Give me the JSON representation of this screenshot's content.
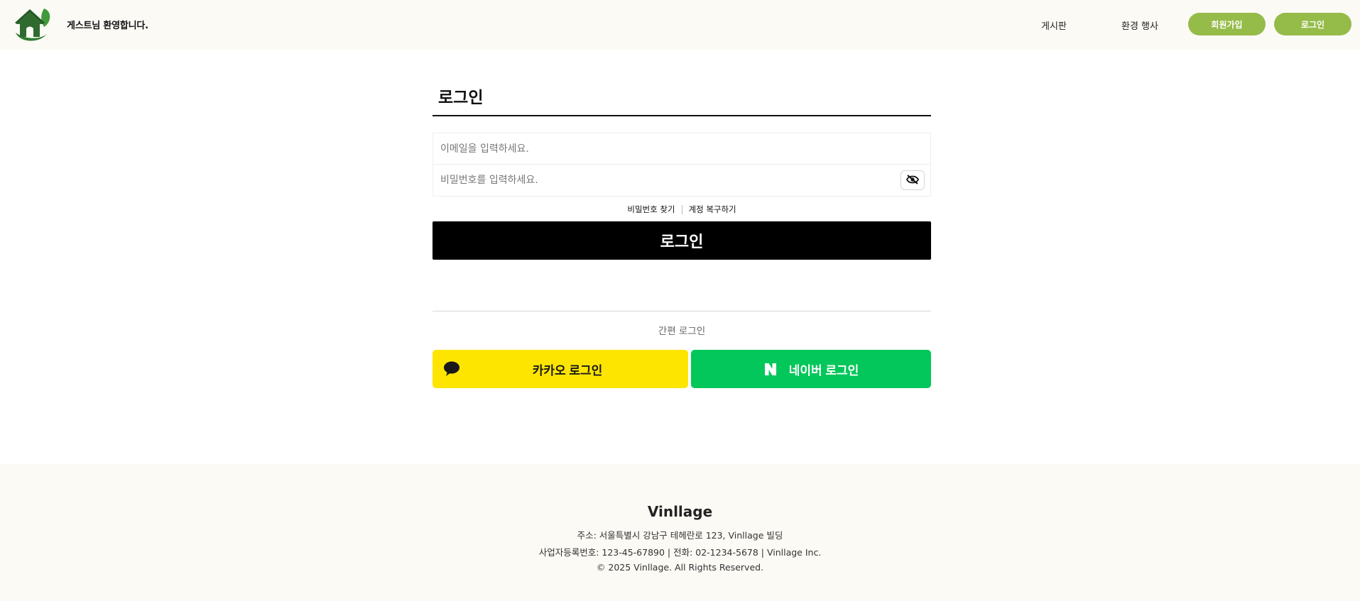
{
  "header": {
    "welcome_text": "게스트님 환영합니다.",
    "nav": {
      "board": "게시판",
      "events": "환경 행사"
    },
    "signup_label": "회원가입",
    "login_label": "로그인",
    "accent_color": "#95bb49",
    "logo_icon": "house-leaf-logo-icon"
  },
  "login": {
    "title": "로그인",
    "email_placeholder": "이메일을 입력하세요.",
    "password_placeholder": "비밀번호를 입력하세요.",
    "toggle_visibility_icon": "eye-slash-icon",
    "find_password": "비밀번호 찾기",
    "recover_account": "계정 복구하기",
    "submit_label": "로그인"
  },
  "social": {
    "section_label": "간편 로그인",
    "kakao_label": "카카오 로그인",
    "kakao_color": "#fee500",
    "kakao_icon": "speech-bubble-icon",
    "naver_label": "네이버 로그인",
    "naver_color": "#03c75a",
    "naver_icon": "naver-n-icon"
  },
  "footer": {
    "brand": "Vinllage",
    "address": "주소: 서울특별시 강남구 테헤란로 123, Vinllage 빌딩",
    "business_info": "사업자등록번호: 123-45-67890 | 전화: 02-1234-5678 | Vinllage Inc.",
    "copyright": "© 2025 Vinllage. All Rights Reserved."
  }
}
